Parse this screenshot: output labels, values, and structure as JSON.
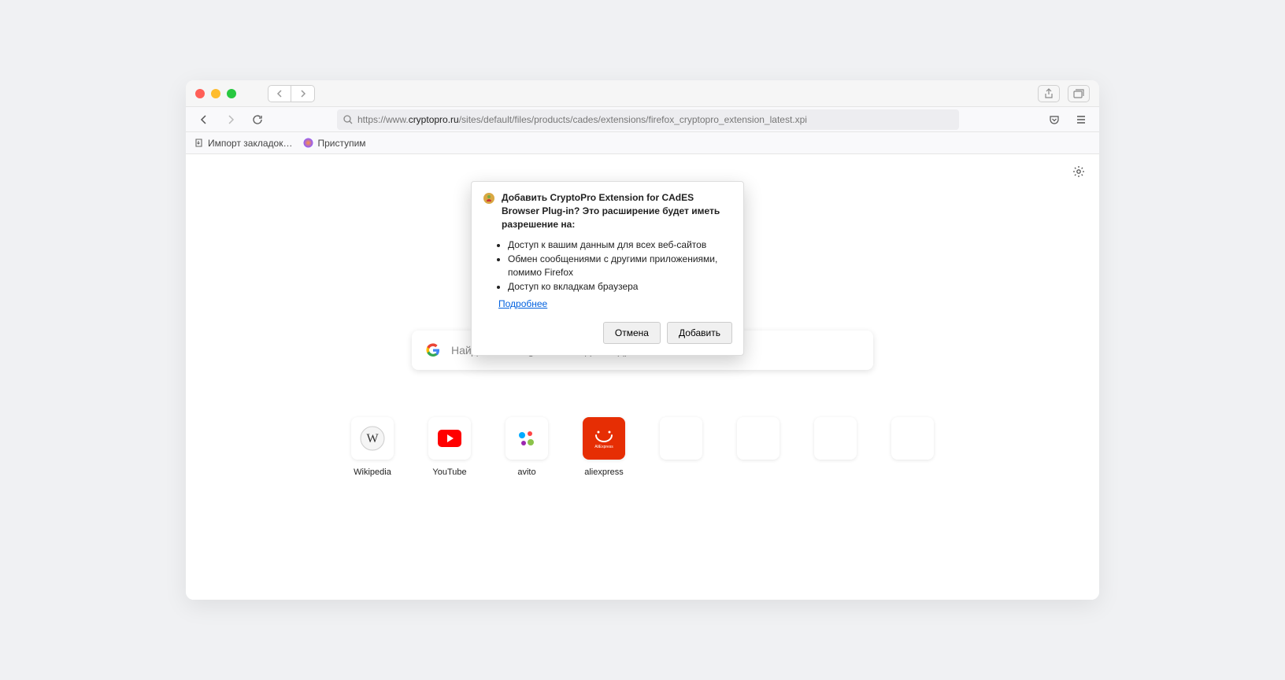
{
  "url": {
    "prefix": "https://www.",
    "domain": "cryptopro.ru",
    "path": "/sites/default/files/products/cades/extensions/firefox_cryptopro_extension_latest.xpi"
  },
  "bookmarks": {
    "import": "Импорт закладок…",
    "getting_started": "Приступим"
  },
  "brand": "Firefox",
  "search": {
    "placeholder": "Найдите в Google или введите адрес"
  },
  "tiles": [
    {
      "label": "Wikipedia"
    },
    {
      "label": "YouTube"
    },
    {
      "label": "avito"
    },
    {
      "label": "aliexpress"
    },
    {
      "label": ""
    },
    {
      "label": ""
    },
    {
      "label": ""
    },
    {
      "label": ""
    }
  ],
  "popup": {
    "title": "Добавить CryptoPro Extension for CAdES Browser Plug-in? Это расширение будет иметь разрешение на:",
    "permissions": [
      "Доступ к вашим данным для всех веб-сайтов",
      "Обмен сообщениями с другими приложениями, помимо Firefox",
      "Доступ ко вкладкам браузера"
    ],
    "more_link": "Подробнее",
    "cancel": "Отмена",
    "add": "Добавить"
  }
}
